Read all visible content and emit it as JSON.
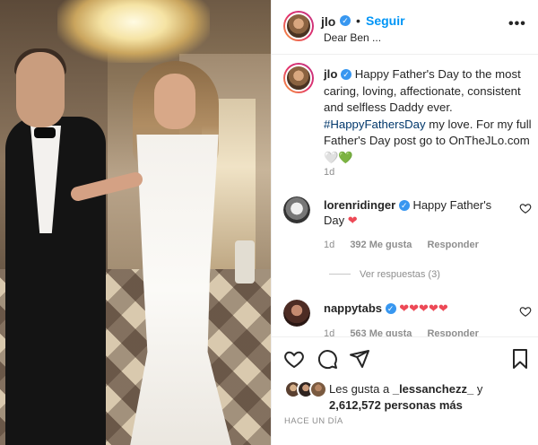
{
  "post": {
    "header": {
      "username": "jlo",
      "dot": "•",
      "follow_label": "Seguir",
      "subtitle": "Dear Ben ...",
      "more_label": "•••"
    },
    "caption": {
      "username": "jlo",
      "text_part1": "Happy Father's Day to the most caring, loving, affectionate, consistent and selfless Daddy ever.",
      "hashtag": "#HappyFathersDay",
      "text_part2": "my love. For my full Father's Day post go to OnTheJLo.com",
      "emoji": "🤍💚",
      "time": "1d"
    },
    "comments": [
      {
        "username": "lorenridinger",
        "text": "Happy Father's Day",
        "emoji": "❤",
        "time": "1d",
        "likes": "392 Me gusta",
        "reply_label": "Responder",
        "view_replies": "Ver respuestas (3)"
      },
      {
        "username": "nappytabs",
        "text": "",
        "emoji": "❤❤❤❤❤",
        "time": "1d",
        "likes": "563 Me gusta",
        "reply_label": "Responder"
      }
    ],
    "likes": {
      "prefix": "Les gusta a",
      "liker": "_lessanchezz_",
      "conjunction": "y",
      "count": "2,612,572 personas más"
    },
    "date": "HACE UN DÍA"
  },
  "colors": {
    "accent": "#0095f6",
    "verified": "#3897f0",
    "heart": "#ed4956",
    "secondary_text": "#8e8e8e",
    "hashtag": "#00376b"
  },
  "icons": {
    "verified": "verified-badge-icon",
    "like": "heart-icon",
    "comment": "comment-bubble-icon",
    "share": "paper-plane-icon",
    "save": "bookmark-icon",
    "more": "more-dots-icon"
  }
}
